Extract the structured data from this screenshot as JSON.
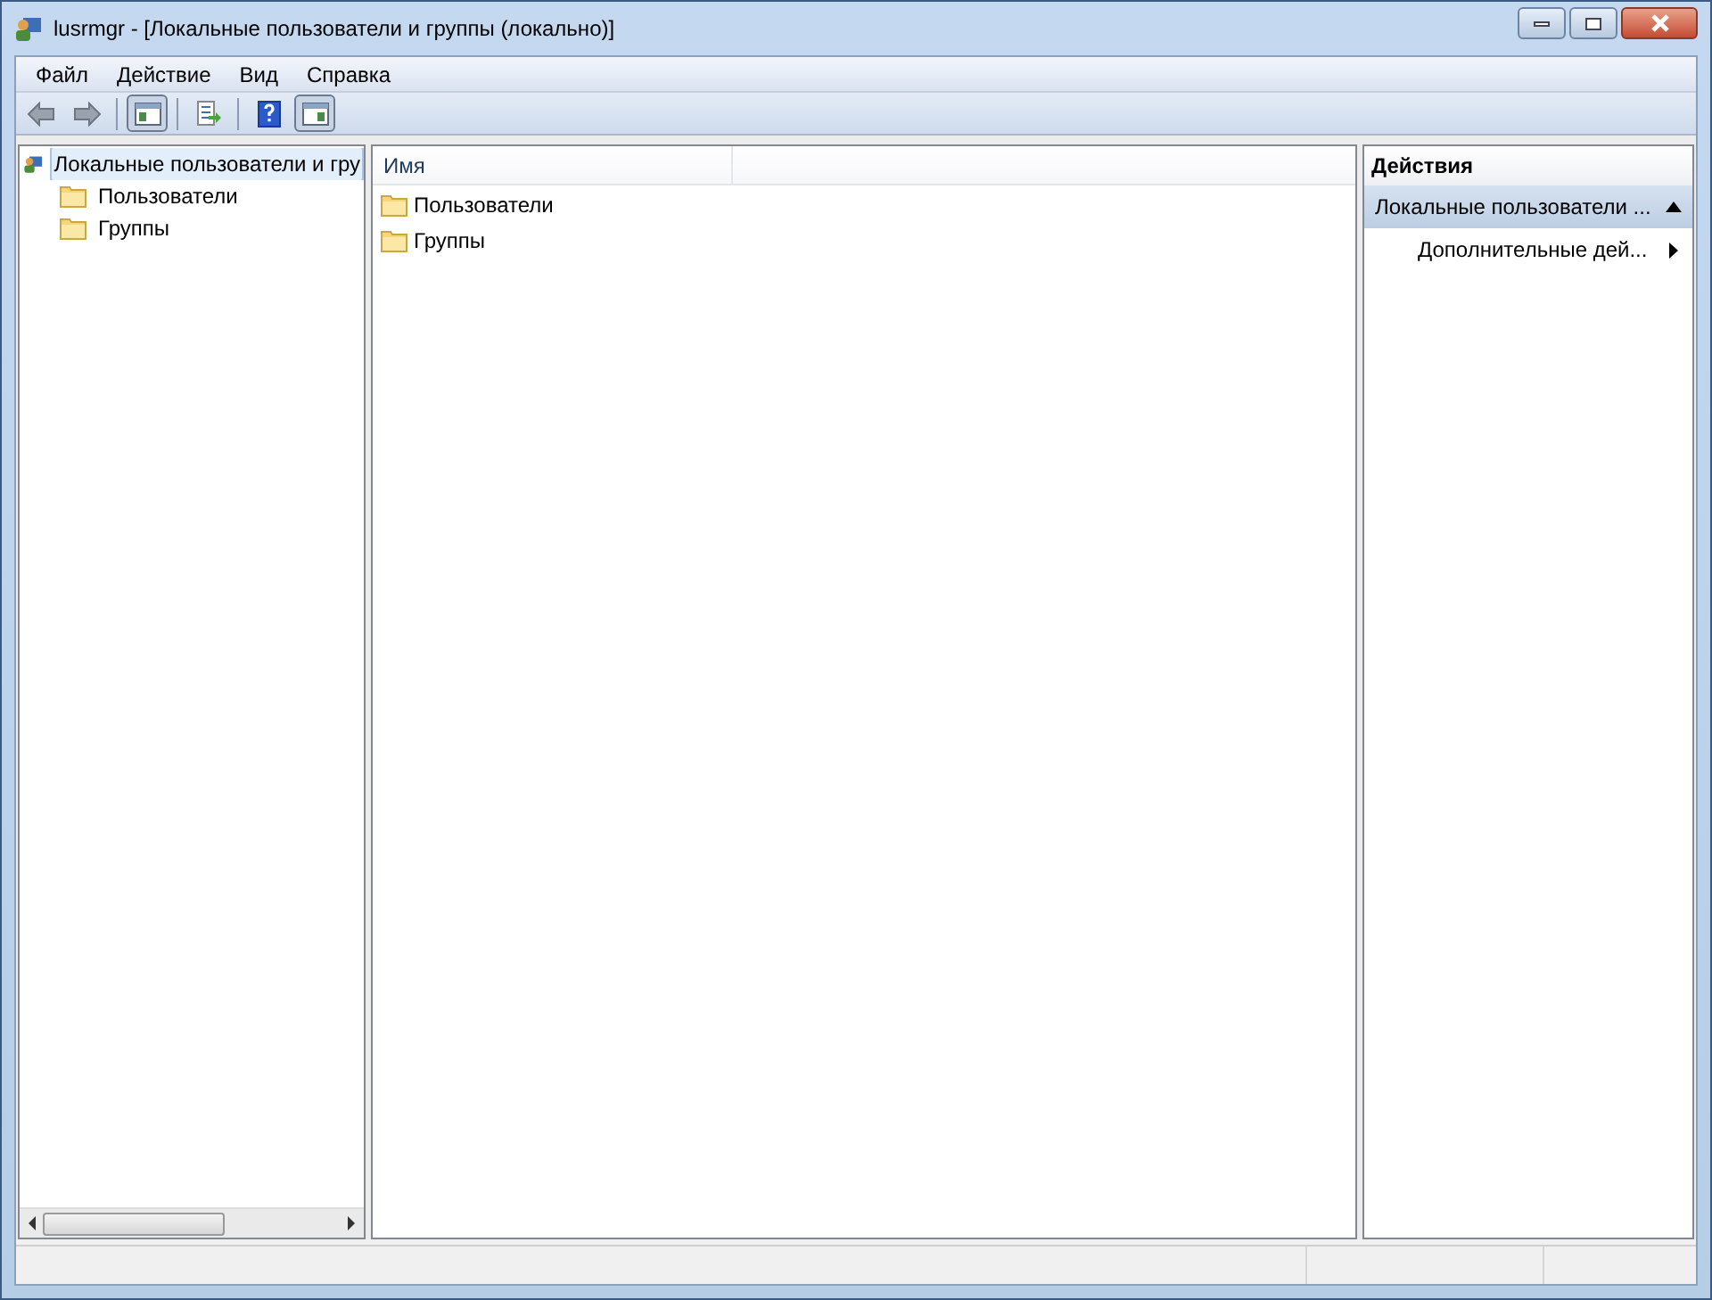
{
  "window": {
    "title": "lusrmgr - [Локальные пользователи и группы (локально)]"
  },
  "menu": [
    "Файл",
    "Действие",
    "Вид",
    "Справка"
  ],
  "toolbar": [
    {
      "kind": "back",
      "pressed": false
    },
    {
      "kind": "forward",
      "pressed": false
    },
    {
      "kind": "sep"
    },
    {
      "kind": "tree",
      "pressed": true
    },
    {
      "kind": "sep"
    },
    {
      "kind": "export",
      "pressed": false
    },
    {
      "kind": "sep"
    },
    {
      "kind": "help",
      "pressed": false
    },
    {
      "kind": "actionpane",
      "pressed": true
    }
  ],
  "tree": {
    "label": "Локальные пользователи и гру",
    "selected": true,
    "children": [
      {
        "label": "Пользователи",
        "selected": false
      },
      {
        "label": "Группы",
        "selected": false
      }
    ]
  },
  "list": {
    "columns": [
      "Имя"
    ],
    "rows": [
      "Пользователи",
      "Группы"
    ]
  },
  "actions": {
    "title": "Действия",
    "sections": [
      {
        "label": "Локальные пользователи ...",
        "expanded": true,
        "items": [
          "Дополнительные дей..."
        ]
      }
    ]
  }
}
